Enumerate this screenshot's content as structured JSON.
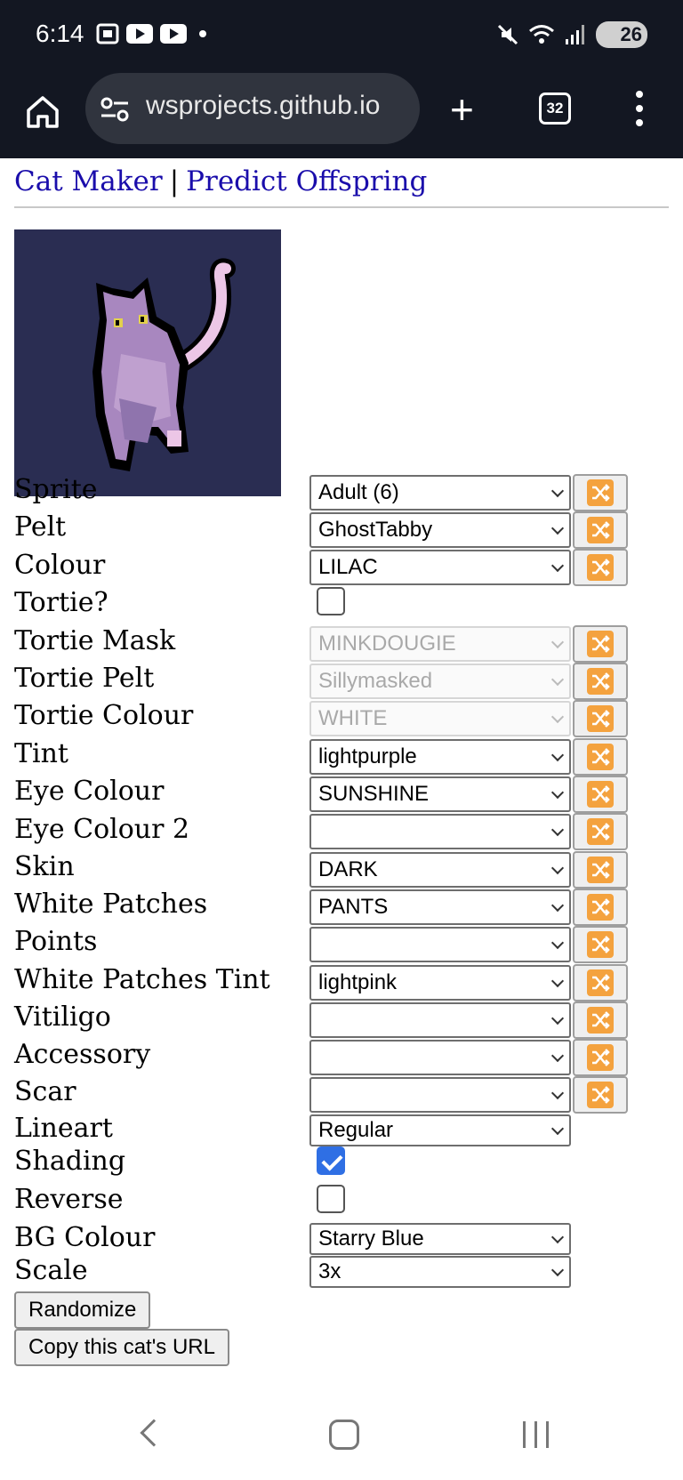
{
  "status_bar": {
    "time": "6:14",
    "battery": "26"
  },
  "browser": {
    "url": "wsprojects.github.io",
    "tab_count": "32"
  },
  "nav": {
    "cat_maker": "Cat Maker",
    "separator": "|",
    "predict": "Predict Offspring"
  },
  "fields": {
    "sprite": {
      "label": "Sprite",
      "value": "Adult (6)"
    },
    "pelt": {
      "label": "Pelt",
      "value": "GhostTabby"
    },
    "colour": {
      "label": "Colour",
      "value": "LILAC"
    },
    "tortie": {
      "label": "Tortie?",
      "checked": false
    },
    "tortie_mask": {
      "label": "Tortie Mask",
      "value": "MINKDOUGIE"
    },
    "tortie_pelt": {
      "label": "Tortie Pelt",
      "value": "Sillymasked"
    },
    "tortie_colour": {
      "label": "Tortie Colour",
      "value": "WHITE"
    },
    "tint": {
      "label": "Tint",
      "value": "lightpurple"
    },
    "eye_colour": {
      "label": "Eye Colour",
      "value": "SUNSHINE"
    },
    "eye_colour_2": {
      "label": "Eye Colour 2",
      "value": ""
    },
    "skin": {
      "label": "Skin",
      "value": "DARK"
    },
    "white_patches": {
      "label": "White Patches",
      "value": "PANTS"
    },
    "points": {
      "label": "Points",
      "value": ""
    },
    "white_patches_tint": {
      "label": "White Patches Tint",
      "value": "lightpink"
    },
    "vitiligo": {
      "label": "Vitiligo",
      "value": ""
    },
    "accessory": {
      "label": "Accessory",
      "value": ""
    },
    "scar": {
      "label": "Scar",
      "value": ""
    },
    "lineart": {
      "label": "Lineart",
      "value": "Regular"
    },
    "shading": {
      "label": "Shading",
      "checked": true
    },
    "reverse": {
      "label": "Reverse",
      "checked": false
    },
    "bg_colour": {
      "label": "BG Colour",
      "value": "Starry Blue"
    },
    "scale": {
      "label": "Scale",
      "value": "3x"
    }
  },
  "buttons": {
    "randomize": "Randomize",
    "copy_url": "Copy this cat's URL"
  },
  "colors": {
    "link": "#1a0dab",
    "shuffle": "#f4a23e",
    "sprite_bg": "#2a2d52",
    "check": "#2f6fe4"
  }
}
